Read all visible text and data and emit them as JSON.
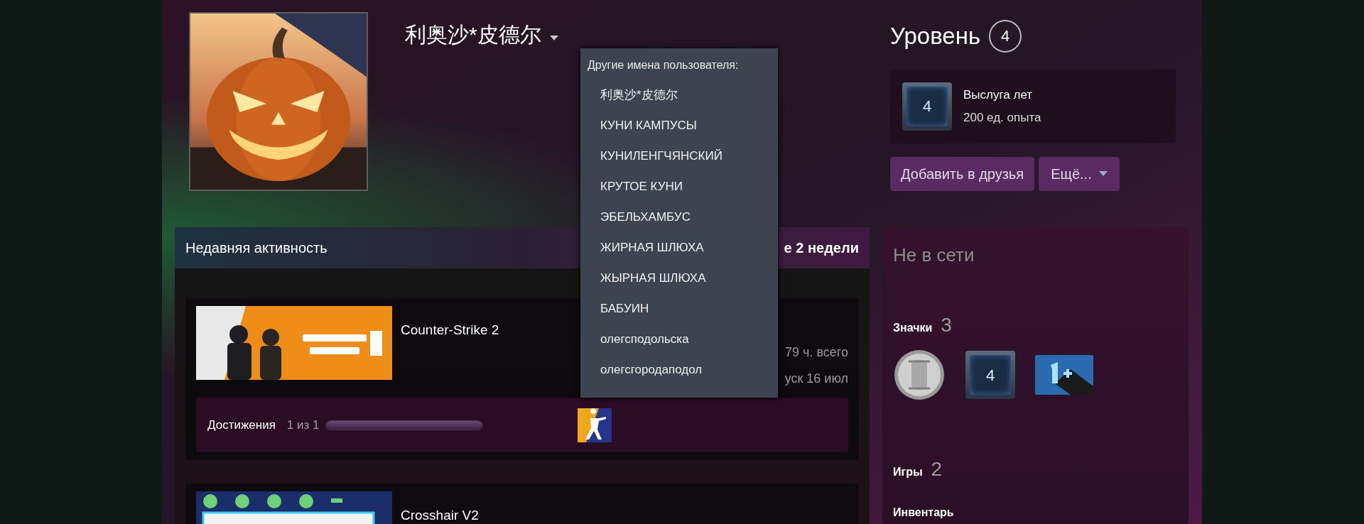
{
  "profile": {
    "name": "利奥沙*皮德尔",
    "aliases_title": "Другие имена пользователя:",
    "aliases": [
      "利奥沙*皮德尔",
      "КУНИ КАМПУСЫ",
      "КУНИЛЕНГЧЯНСКИЙ",
      "КРУТОЕ КУНИ",
      "ЭБЕЛЬХАМБУС",
      "ЖИРНАЯ ШЛЮХА",
      "ЖЫРНАЯ ШЛЮХА",
      "БАБУИН",
      "олегсподольска",
      "олегсгородаподол"
    ]
  },
  "level": {
    "label": "Уровень",
    "value": "4",
    "badge_value": "4",
    "badge_title": "Выслуга лет",
    "badge_xp": "200 ед. опыта"
  },
  "buttons": {
    "add_friend": "Добавить в друзья",
    "more": "Ещё..."
  },
  "activity": {
    "title": "Недавняя активность",
    "summary": "е 2 недели",
    "games": [
      {
        "title": "Counter-Strike 2",
        "hours": "79 ч. всего",
        "last_played": "уск 16 июл",
        "achievements": {
          "label": "Достижения",
          "count": "1 из 1",
          "level": 1
        }
      },
      {
        "title": "Crosshair V2"
      }
    ]
  },
  "sidebar": {
    "status": "Не в сети",
    "badges_label": "Значки",
    "badges_count": "3",
    "badge_level": "4",
    "games_label": "Игры",
    "games_count": "2",
    "inventory_label": "Инвентарь"
  }
}
